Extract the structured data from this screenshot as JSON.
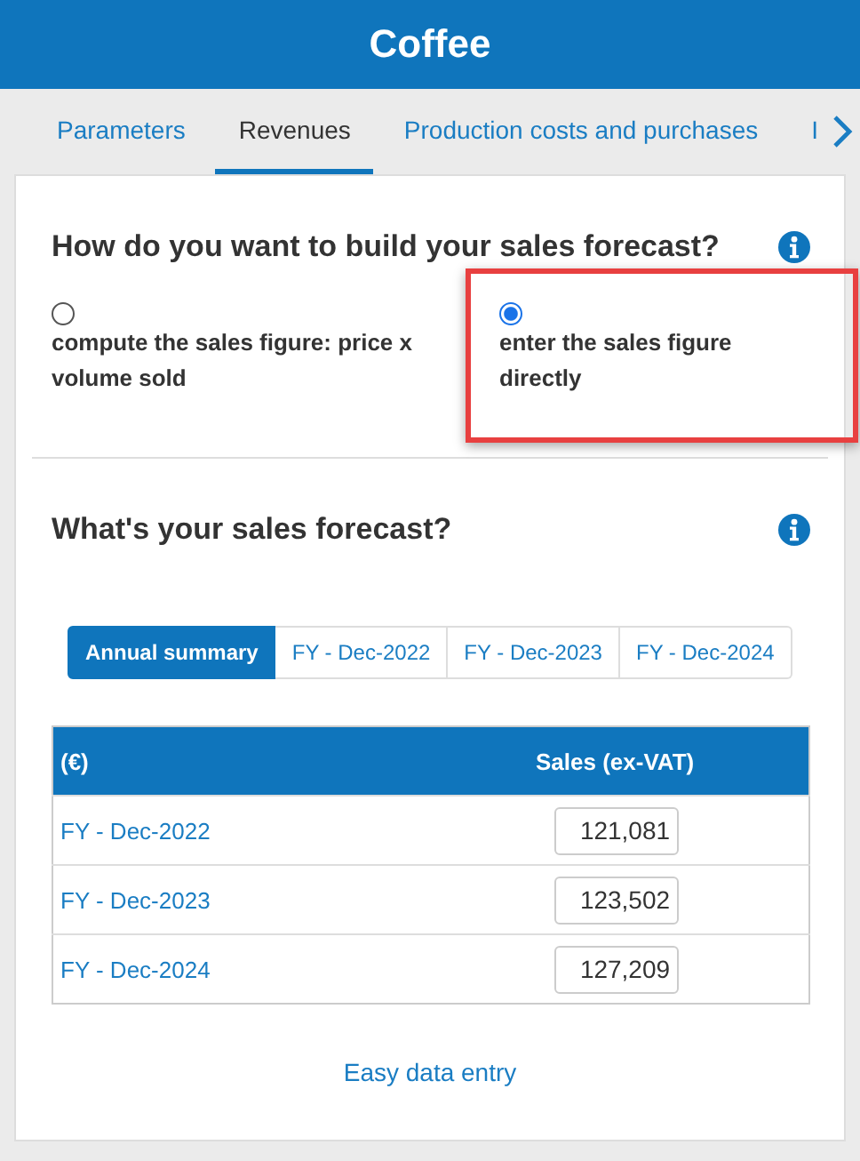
{
  "header": {
    "title": "Coffee"
  },
  "tabs": [
    {
      "label": "Parameters",
      "selected": false
    },
    {
      "label": "Revenues",
      "selected": true
    },
    {
      "label": "Production costs and purchases",
      "selected": false
    },
    {
      "label": "I",
      "selected": false
    }
  ],
  "method": {
    "question": "How do you want to build your sales forecast?",
    "options": [
      {
        "label": "compute the sales figure: price x volume sold",
        "selected": false,
        "highlighted": false
      },
      {
        "label": "enter the sales figure directly",
        "selected": true,
        "highlighted": true
      }
    ]
  },
  "forecast": {
    "question": "What's your sales forecast?",
    "periods": [
      {
        "label": "Annual summary",
        "selected": true
      },
      {
        "label": "FY - Dec-2022",
        "selected": false
      },
      {
        "label": "FY - Dec-2023",
        "selected": false
      },
      {
        "label": "FY - Dec-2024",
        "selected": false
      }
    ],
    "table": {
      "columns": [
        "(€)",
        "Sales (ex-VAT)"
      ],
      "rows": [
        {
          "period": "FY - Dec-2022",
          "sales": "121,081"
        },
        {
          "period": "FY - Dec-2023",
          "sales": "123,502"
        },
        {
          "period": "FY - Dec-2024",
          "sales": "127,209"
        }
      ]
    },
    "link": "Easy data entry"
  }
}
